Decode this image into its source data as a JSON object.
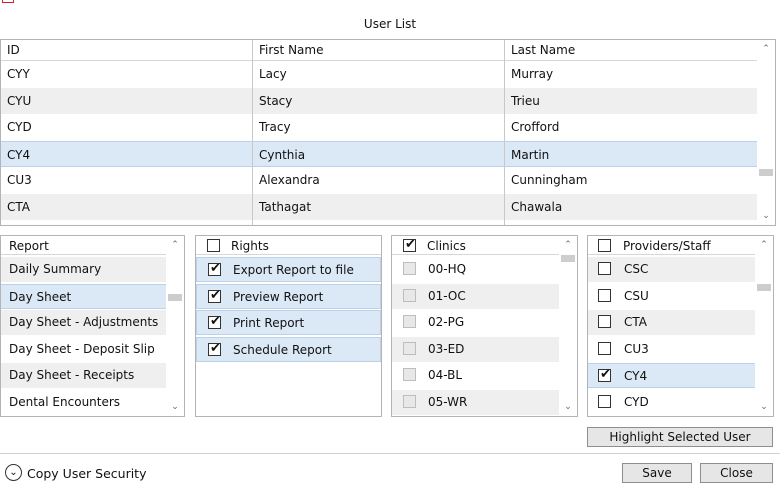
{
  "user_list": {
    "title": "User List",
    "columns": [
      "ID",
      "First Name",
      "Last Name"
    ],
    "rows": [
      {
        "id": "CYY",
        "first": "Lacy",
        "last": "Murray"
      },
      {
        "id": "CYU",
        "first": "Stacy",
        "last": "Trieu"
      },
      {
        "id": "CYD",
        "first": "Tracy",
        "last": "Crofford"
      },
      {
        "id": "CY4",
        "first": "Cynthia",
        "last": "Martin",
        "selected": true
      },
      {
        "id": "CU3",
        "first": "Alexandra",
        "last": "Cunningham"
      },
      {
        "id": "CTA",
        "first": "Tathagat",
        "last": "Chawala"
      }
    ]
  },
  "report": {
    "header": "Report",
    "items": [
      {
        "label": "Daily Summary"
      },
      {
        "label": "Day Sheet",
        "selected": true
      },
      {
        "label": "Day Sheet - Adjustments"
      },
      {
        "label": "Day Sheet - Deposit Slip"
      },
      {
        "label": "Day Sheet - Receipts"
      },
      {
        "label": "Dental Encounters"
      }
    ]
  },
  "rights": {
    "header": "Rights",
    "header_checked": false,
    "items": [
      {
        "label": "Export Report to file",
        "checked": true
      },
      {
        "label": "Preview Report",
        "checked": true
      },
      {
        "label": "Print Report",
        "checked": true
      },
      {
        "label": "Schedule Report",
        "checked": true
      }
    ]
  },
  "clinics": {
    "header": "Clinics",
    "header_checked": true,
    "items": [
      {
        "label": "00-HQ",
        "checked": false,
        "disabled": true
      },
      {
        "label": "01-OC",
        "checked": false,
        "disabled": true
      },
      {
        "label": "02-PG",
        "checked": false,
        "disabled": true
      },
      {
        "label": "03-ED",
        "checked": false,
        "disabled": true
      },
      {
        "label": "04-BL",
        "checked": false,
        "disabled": true
      },
      {
        "label": "05-WR",
        "checked": false,
        "disabled": true
      }
    ]
  },
  "providers": {
    "header": "Providers/Staff",
    "header_checked": false,
    "items": [
      {
        "label": "CSC",
        "checked": false
      },
      {
        "label": "CSU",
        "checked": false
      },
      {
        "label": "CTA",
        "checked": false
      },
      {
        "label": "CU3",
        "checked": false
      },
      {
        "label": "CY4",
        "checked": true,
        "selected": true
      },
      {
        "label": "CYD",
        "checked": false
      }
    ]
  },
  "buttons": {
    "highlight": "Highlight Selected User",
    "save": "Save",
    "close": "Close"
  },
  "footer": {
    "copy_security": "Copy User Security"
  },
  "icons": {
    "check": "check-icon",
    "expand": "chevron-down-circle-icon",
    "scroll_up": "chevron-up-icon",
    "scroll_down": "chevron-down-icon"
  }
}
